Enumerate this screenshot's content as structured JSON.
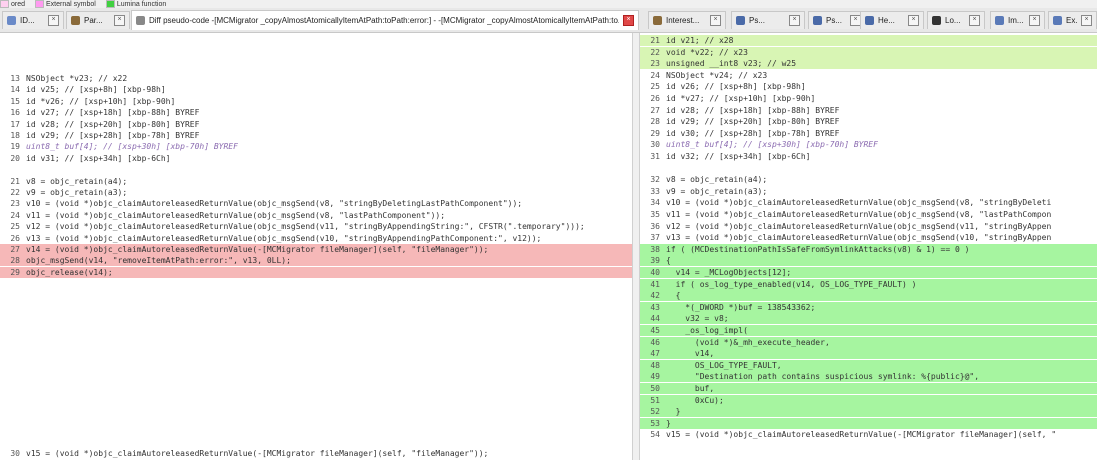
{
  "legend": {
    "items": [
      {
        "label": "ored",
        "color": "#ffd0f0"
      },
      {
        "label": "External symbol",
        "color": "#ff9af0"
      },
      {
        "label": "Lumina function",
        "color": "#40d040"
      }
    ]
  },
  "tabs": [
    {
      "label": "ID...",
      "icon": "document-icon",
      "color": "#6a8ac8",
      "active": false
    },
    {
      "label": "Par...",
      "icon": "bat-icon",
      "color": "#8a6a3a",
      "active": false
    },
    {
      "label": "Diff pseudo-code -[MCMigrator _copyAlmostAtomicallyItemAtPath:toPath:error:] - -[MCMigrator _copyAlmostAtomicallyItemAtPath:to...",
      "icon": "diff-icon",
      "color": "#888888",
      "active": true
    },
    {
      "label": "Interest...",
      "icon": "bat-icon",
      "color": "#8a6a3a",
      "active": false
    },
    {
      "label": "Ps...",
      "icon": "pseudocode-icon",
      "color": "#4a6aa8",
      "active": false
    },
    {
      "label": "Ps...",
      "icon": "pseudocode-icon",
      "color": "#4a6aa8",
      "active": false
    },
    {
      "label": "He...",
      "icon": "hex-icon",
      "color": "#4a6aa8",
      "active": false
    },
    {
      "label": "Lo...",
      "icon": "locals-icon",
      "color": "#333333",
      "active": false
    },
    {
      "label": "Im...",
      "icon": "imports-icon",
      "color": "#5a7ab8",
      "active": false
    },
    {
      "label": "Ex...",
      "icon": "exports-icon",
      "color": "#5a7ab8",
      "active": false
    }
  ],
  "left_lines": [
    {
      "n": "13",
      "t": "NSObject *v23; // x22",
      "s": ""
    },
    {
      "n": "14",
      "t": "id v25; // [xsp+8h] [xbp-98h]",
      "s": ""
    },
    {
      "n": "15",
      "t": "id *v26; // [xsp+10h] [xbp-90h]",
      "s": ""
    },
    {
      "n": "16",
      "t": "id v27; // [xsp+18h] [xbp-88h] BYREF",
      "s": ""
    },
    {
      "n": "17",
      "t": "id v28; // [xsp+20h] [xbp-80h] BYREF",
      "s": ""
    },
    {
      "n": "18",
      "t": "id v29; // [xsp+28h] [xbp-78h] BYREF",
      "s": ""
    },
    {
      "n": "19",
      "t": "uint8_t buf[4]; // [xsp+30h] [xbp-70h] BYREF",
      "s": "ital"
    },
    {
      "n": "20",
      "t": "id v31; // [xsp+34h] [xbp-6Ch]",
      "s": ""
    },
    {
      "n": "",
      "t": "",
      "s": ""
    },
    {
      "n": "21",
      "t": "v8 = objc_retain(a4);",
      "s": ""
    },
    {
      "n": "22",
      "t": "v9 = objc_retain(a3);",
      "s": ""
    },
    {
      "n": "23",
      "t": "v10 = (void *)objc_claimAutoreleasedReturnValue(objc_msgSend(v8, \"stringByDeletingLastPathComponent\"));",
      "s": ""
    },
    {
      "n": "24",
      "t": "v11 = (void *)objc_claimAutoreleasedReturnValue(objc_msgSend(v8, \"lastPathComponent\"));",
      "s": ""
    },
    {
      "n": "25",
      "t": "v12 = (void *)objc_claimAutoreleasedReturnValue(objc_msgSend(v11, \"stringByAppendingString:\", CFSTR(\".temporary\")));",
      "s": ""
    },
    {
      "n": "26",
      "t": "v13 = (void *)objc_claimAutoreleasedReturnValue(objc_msgSend(v10, \"stringByAppendingPathComponent:\", v12));",
      "s": ""
    },
    {
      "n": "27",
      "t": "v14 = (void *)objc_claimAutoreleasedReturnValue(-[MCMigrator fileManager](self, \"fileManager\"));",
      "s": "del"
    },
    {
      "n": "28",
      "t": "objc_msgSend(v14, \"removeItemAtPath:error:\", v13, 0LL);",
      "s": "del"
    },
    {
      "n": "29",
      "t": "objc_release(v14);",
      "s": "del"
    }
  ],
  "left_bottom": {
    "n": "30",
    "t": "v15 = (void *)objc_claimAutoreleasedReturnValue(-[MCMigrator fileManager](self, \"fileManager\"));"
  },
  "right_lines": [
    {
      "n": "21",
      "t": "id v21; // x28",
      "s": "chg"
    },
    {
      "n": "22",
      "t": "void *v22; // x23",
      "s": "chg"
    },
    {
      "n": "23",
      "t": "unsigned __int8 v23; // w25",
      "s": "chg"
    },
    {
      "n": "24",
      "t": "NSObject *v24; // x23",
      "s": ""
    },
    {
      "n": "25",
      "t": "id v26; // [xsp+8h] [xbp-98h]",
      "s": ""
    },
    {
      "n": "26",
      "t": "id *v27; // [xsp+10h] [xbp-90h]",
      "s": ""
    },
    {
      "n": "27",
      "t": "id v28; // [xsp+18h] [xbp-88h] BYREF",
      "s": ""
    },
    {
      "n": "28",
      "t": "id v29; // [xsp+20h] [xbp-80h] BYREF",
      "s": ""
    },
    {
      "n": "29",
      "t": "id v30; // [xsp+28h] [xbp-78h] BYREF",
      "s": ""
    },
    {
      "n": "30",
      "t": "uint8_t buf[4]; // [xsp+30h] [xbp-70h] BYREF",
      "s": "ital"
    },
    {
      "n": "31",
      "t": "id v32; // [xsp+34h] [xbp-6Ch]",
      "s": ""
    },
    {
      "n": "",
      "t": "",
      "s": ""
    },
    {
      "n": "32",
      "t": "v8 = objc_retain(a4);",
      "s": ""
    },
    {
      "n": "33",
      "t": "v9 = objc_retain(a3);",
      "s": ""
    },
    {
      "n": "34",
      "t": "v10 = (void *)objc_claimAutoreleasedReturnValue(objc_msgSend(v8, \"stringByDeleti",
      "s": ""
    },
    {
      "n": "35",
      "t": "v11 = (void *)objc_claimAutoreleasedReturnValue(objc_msgSend(v8, \"lastPathCompon",
      "s": ""
    },
    {
      "n": "36",
      "t": "v12 = (void *)objc_claimAutoreleasedReturnValue(objc_msgSend(v11, \"stringByAppen",
      "s": ""
    },
    {
      "n": "37",
      "t": "v13 = (void *)objc_claimAutoreleasedReturnValue(objc_msgSend(v10, \"stringByAppen",
      "s": ""
    },
    {
      "n": "38",
      "t": "if ( (MCDestinationPathIsSafeFromSymlinkAttacks(v8) & 1) == 0 )",
      "s": "add"
    },
    {
      "n": "39",
      "t": "{",
      "s": "add"
    },
    {
      "n": "40",
      "t": "  v14 = _MCLogObjects[12];",
      "s": "add"
    },
    {
      "n": "41",
      "t": "  if ( os_log_type_enabled(v14, OS_LOG_TYPE_FAULT) )",
      "s": "add"
    },
    {
      "n": "42",
      "t": "  {",
      "s": "add"
    },
    {
      "n": "43",
      "t": "    *(_DWORD *)buf = 138543362;",
      "s": "add"
    },
    {
      "n": "44",
      "t": "    v32 = v8;",
      "s": "add"
    },
    {
      "n": "45",
      "t": "    _os_log_impl(",
      "s": "add"
    },
    {
      "n": "46",
      "t": "      (void *)&_mh_execute_header,",
      "s": "add"
    },
    {
      "n": "47",
      "t": "      v14,",
      "s": "add"
    },
    {
      "n": "48",
      "t": "      OS_LOG_TYPE_FAULT,",
      "s": "add"
    },
    {
      "n": "49",
      "t": "      \"Destination path contains suspicious symlink: %{public}@\",",
      "s": "add"
    },
    {
      "n": "50",
      "t": "      buf,",
      "s": "add"
    },
    {
      "n": "51",
      "t": "      0xCu);",
      "s": "add"
    },
    {
      "n": "52",
      "t": "  }",
      "s": "add"
    },
    {
      "n": "53",
      "t": "}",
      "s": "add"
    },
    {
      "n": "54",
      "t": "v15 = (void *)objc_claimAutoreleasedReturnValue(-[MCMigrator fileManager](self, \"",
      "s": ""
    }
  ]
}
